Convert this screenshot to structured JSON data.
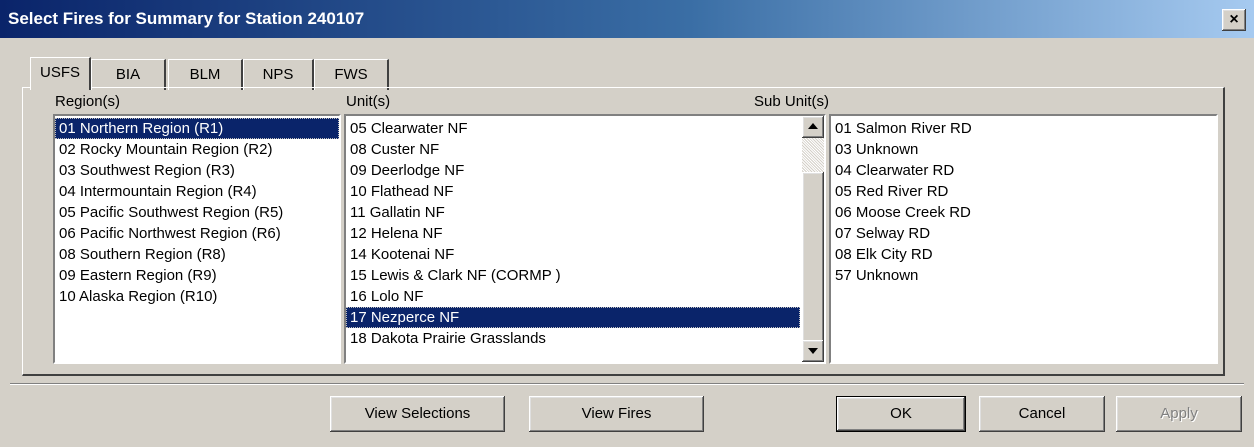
{
  "window": {
    "title": "Select Fires for Summary for Station 240107",
    "close_glyph": "×"
  },
  "tabs": [
    {
      "label": "USFS",
      "active": true
    },
    {
      "label": "BIA",
      "active": false
    },
    {
      "label": "BLM",
      "active": false
    },
    {
      "label": "NPS",
      "active": false
    },
    {
      "label": "FWS",
      "active": false
    }
  ],
  "regions": {
    "label": "Region(s)",
    "items": [
      "01 Northern Region (R1)",
      "02 Rocky Mountain Region (R2)",
      "03 Southwest Region (R3)",
      "04 Intermountain Region (R4)",
      "05 Pacific Southwest Region (R5)",
      "06 Pacific Northwest Region (R6)",
      "08 Southern Region (R8)",
      "09 Eastern Region (R9)",
      "10 Alaska Region (R10)"
    ],
    "selected_index": 0
  },
  "units": {
    "label": "Unit(s)",
    "items": [
      "05 Clearwater NF",
      "08 Custer NF",
      "09 Deerlodge NF",
      "10 Flathead NF",
      "11 Gallatin NF",
      "12 Helena NF",
      "14 Kootenai NF",
      "15 Lewis & Clark NF (CORMP )",
      "16 Lolo NF",
      "17 Nezperce NF",
      "18 Dakota Prairie Grasslands"
    ],
    "selected_index": 9
  },
  "subunits": {
    "label": "Sub Unit(s)",
    "items": [
      "01 Salmon River RD",
      "03 Unknown",
      "04 Clearwater RD",
      "05 Red River RD",
      "06 Moose Creek RD",
      "07 Selway RD",
      "08 Elk City RD",
      "57 Unknown"
    ]
  },
  "buttons": {
    "view_selections": "View Selections",
    "view_fires": "View Fires",
    "ok": "OK",
    "cancel": "Cancel",
    "apply": "Apply"
  }
}
